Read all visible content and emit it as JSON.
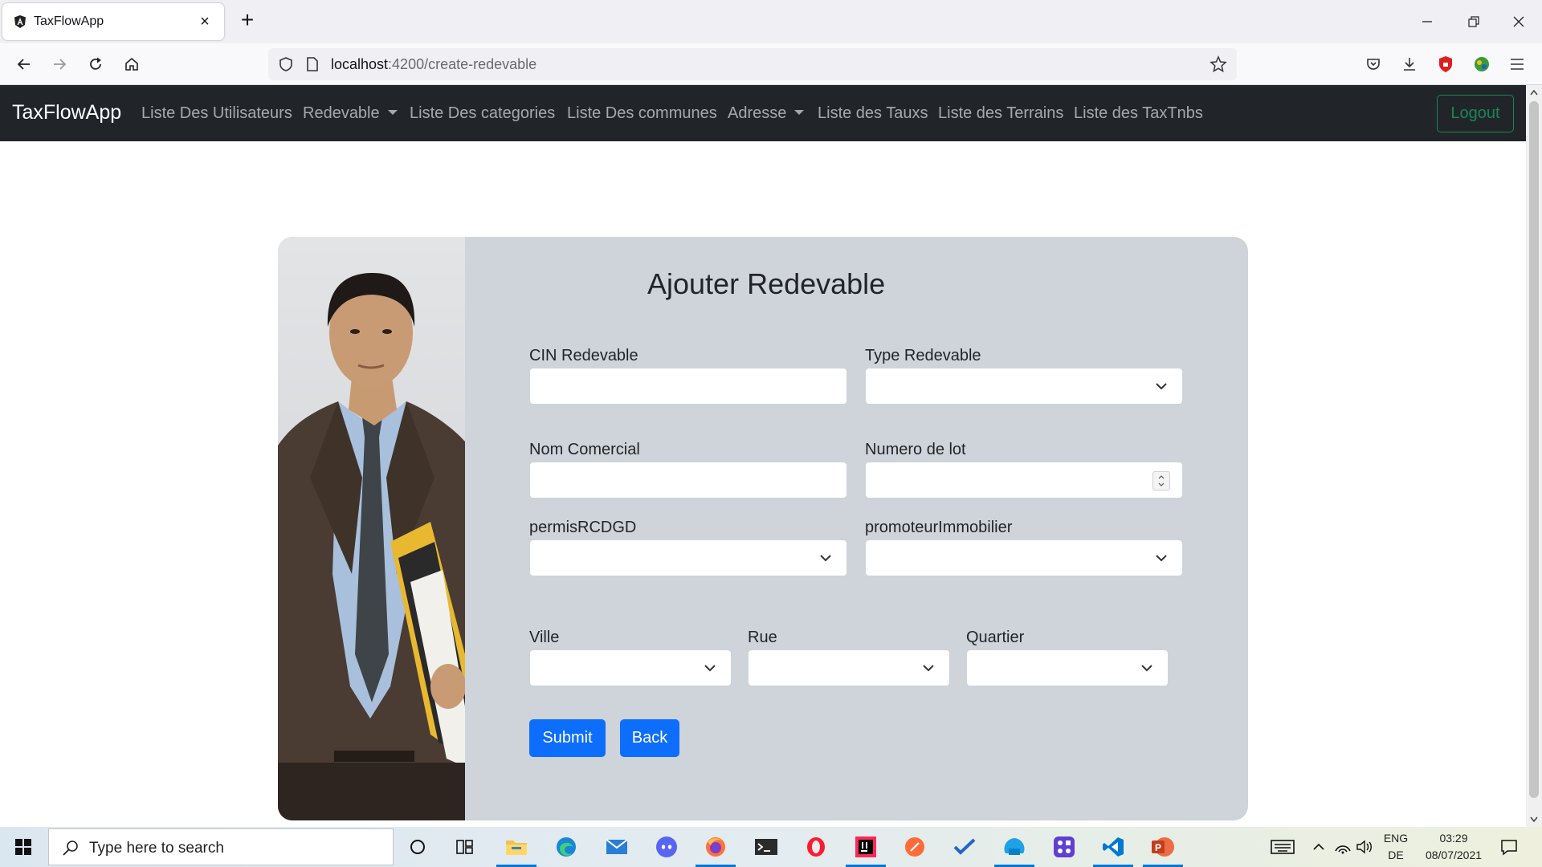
{
  "browser": {
    "tab_title": "TaxFlowApp",
    "url_host": "localhost",
    "url_path": ":4200/create-redevable"
  },
  "navbar": {
    "brand": "TaxFlowApp",
    "links": [
      "Liste Des Utilisateurs",
      "Redevable",
      "Liste Des categories",
      "Liste Des communes",
      "Adresse",
      "Liste des Tauxs",
      "Liste des Terrains",
      "Liste des TaxTnbs"
    ],
    "logout": "Logout"
  },
  "form": {
    "title": "Ajouter Redevable",
    "cin_label": "CIN Redevable",
    "cin_value": "",
    "type_label": "Type Redevable",
    "type_value": "",
    "nom_label": "Nom Comercial",
    "nom_value": "",
    "lot_label": "Numero de lot",
    "lot_value": "",
    "permis_label": "permisRCDGD",
    "permis_value": "",
    "promoteur_label": "promoteurImmobilier",
    "promoteur_value": "",
    "ville_label": "Ville",
    "ville_value": "",
    "rue_label": "Rue",
    "rue_value": "",
    "quartier_label": "Quartier",
    "quartier_value": "",
    "submit": "Submit",
    "back": "Back"
  },
  "taskbar": {
    "search_placeholder": "Type here to search",
    "lang_top": "ENG",
    "lang_bottom": "DE",
    "time": "03:29",
    "date": "08/07/2021"
  },
  "colors": {
    "navbar_bg": "#212529",
    "card_bg": "#ced4da",
    "primary": "#0d6efd",
    "logout": "#198754"
  }
}
